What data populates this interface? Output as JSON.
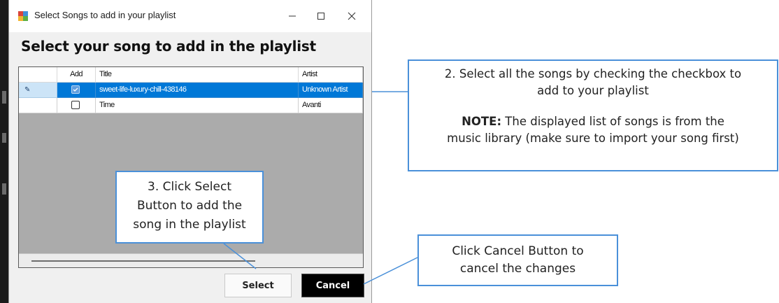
{
  "window": {
    "title": "Select Songs to add in your playlist",
    "controls": {
      "minimize": "—",
      "maximize": "☐",
      "close": "✕"
    }
  },
  "heading": "Select your song to add in the playlist",
  "grid": {
    "columns": [
      "",
      "Add",
      "Title",
      "Artist"
    ],
    "rows": [
      {
        "marker": "✎",
        "checked": true,
        "title": "sweet-life-luxury-chill-438146",
        "artist": "Unknown Artist",
        "selected": true
      },
      {
        "marker": "",
        "checked": false,
        "title": "Time",
        "artist": "Avanti",
        "selected": false
      }
    ]
  },
  "buttons": {
    "select": "Select",
    "cancel": "Cancel"
  },
  "callouts": {
    "select_songs": {
      "line1": "2. Select all the songs by checking the checkbox to",
      "line2": "add to your playlist",
      "note_label": "NOTE:",
      "note_text": " The displayed list of songs is from the",
      "line4": "music library (make sure to import your song first)"
    },
    "click_select": {
      "line1": "3. Click Select",
      "line2": "Button to add the",
      "line3": "song in the playlist"
    },
    "click_cancel": {
      "line1": "Click Cancel Button to",
      "line2": "cancel the changes"
    }
  },
  "colors": {
    "selection": "#0078d7",
    "grid_background": "#ababab",
    "callout_border": "#4a90d9",
    "cancel_button": "#000000"
  }
}
